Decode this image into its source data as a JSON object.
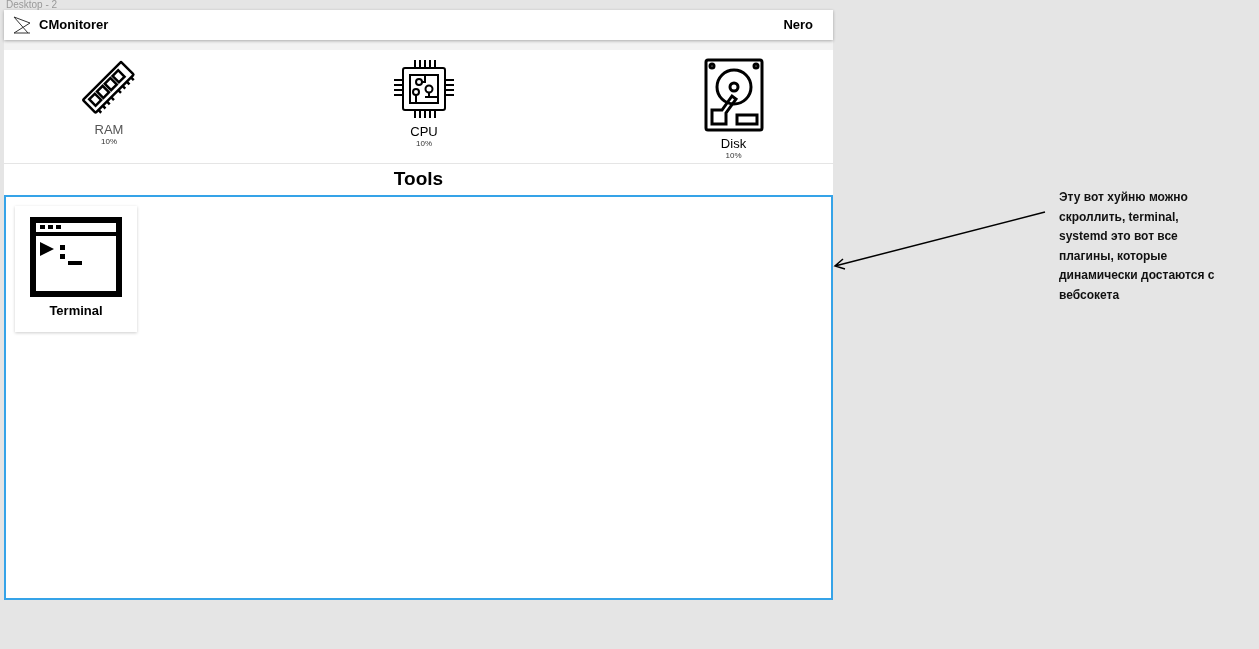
{
  "canvas": {
    "frame_label": "Desktop - 2"
  },
  "header": {
    "title": "CMonitorer",
    "user": "Nero"
  },
  "stats": [
    {
      "kind": "ram",
      "label": "RAM",
      "value": "10%"
    },
    {
      "kind": "cpu",
      "label": "CPU",
      "value": "10%"
    },
    {
      "kind": "disk",
      "label": "Disk",
      "value": "10%"
    }
  ],
  "tools": {
    "title": "Tools",
    "items": [
      {
        "kind": "terminal",
        "label": "Terminal"
      }
    ]
  },
  "annotation": {
    "text": "Эту вот хуйню можно скроллить, terminal, systemd это вот все плагины, которые динамически достаются с вебсокета"
  }
}
